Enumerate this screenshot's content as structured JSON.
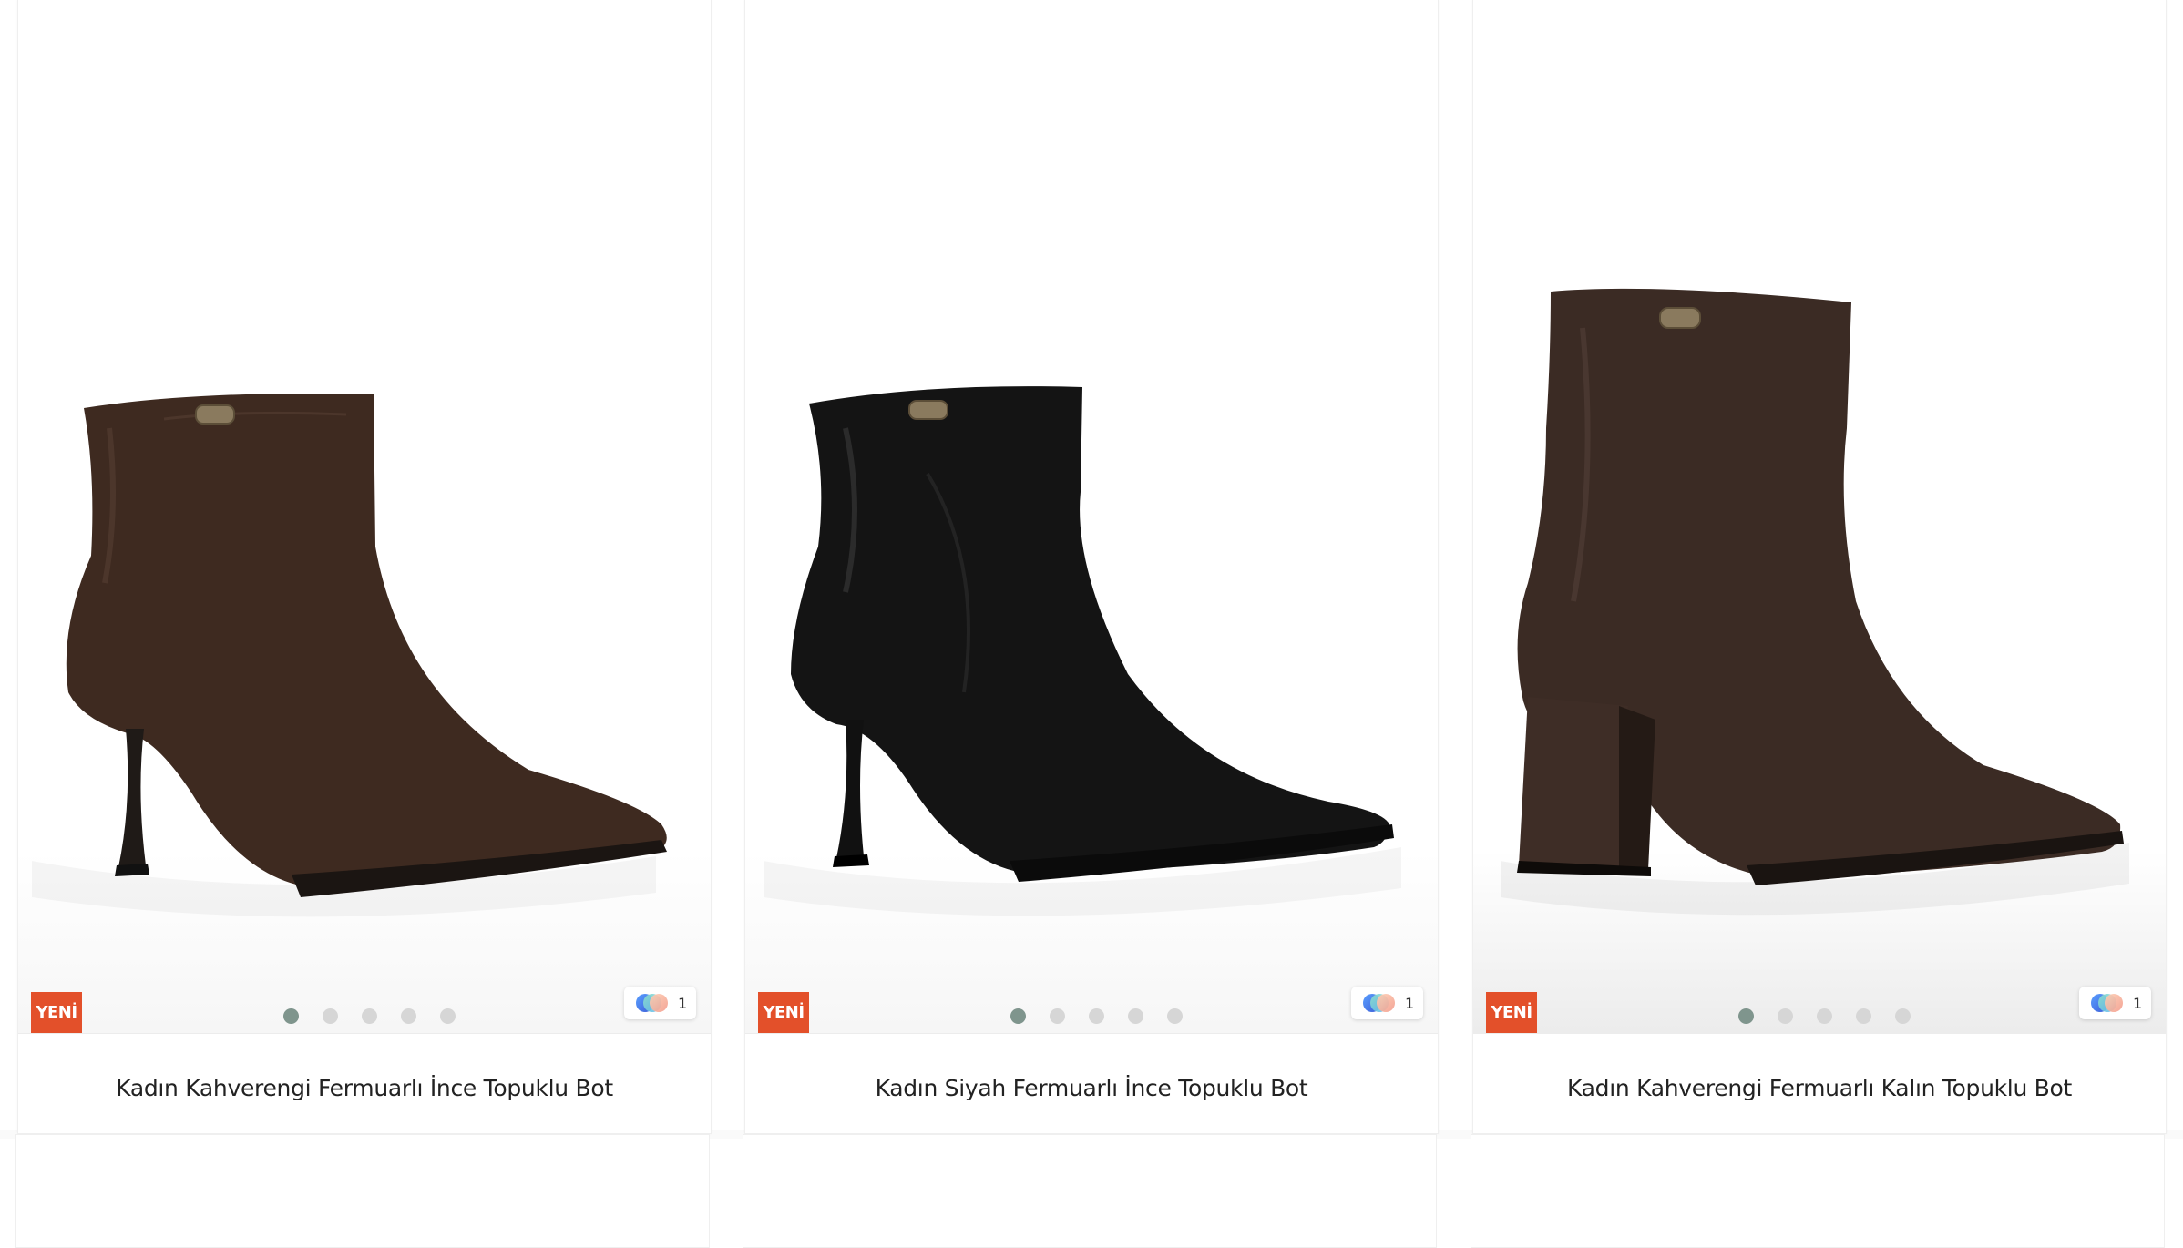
{
  "products": [
    {
      "badge": "YENİ",
      "title": "Kadın Kahverengi Fermuarlı İnce Topuklu Bot",
      "color_count": "1",
      "shoe_color": "#3e2a20",
      "icons": {
        "color_swatch": "color-swatch-icon"
      }
    },
    {
      "badge": "YENİ",
      "title": "Kadın Siyah Fermuarlı İnce Topuklu Bot",
      "color_count": "1",
      "shoe_color": "#141414",
      "icons": {
        "color_swatch": "color-swatch-icon"
      }
    },
    {
      "badge": "YENİ",
      "title": "Kadın Kahverengi Fermuarlı Kalın Topuklu Bot",
      "color_count": "1",
      "shoe_color": "#3b2b24",
      "icons": {
        "color_swatch": "color-swatch-icon"
      }
    }
  ],
  "colors": {
    "badge_bg": "#e3502a",
    "dot_active": "#7f958d",
    "dot_inactive": "#d6d6d6"
  }
}
